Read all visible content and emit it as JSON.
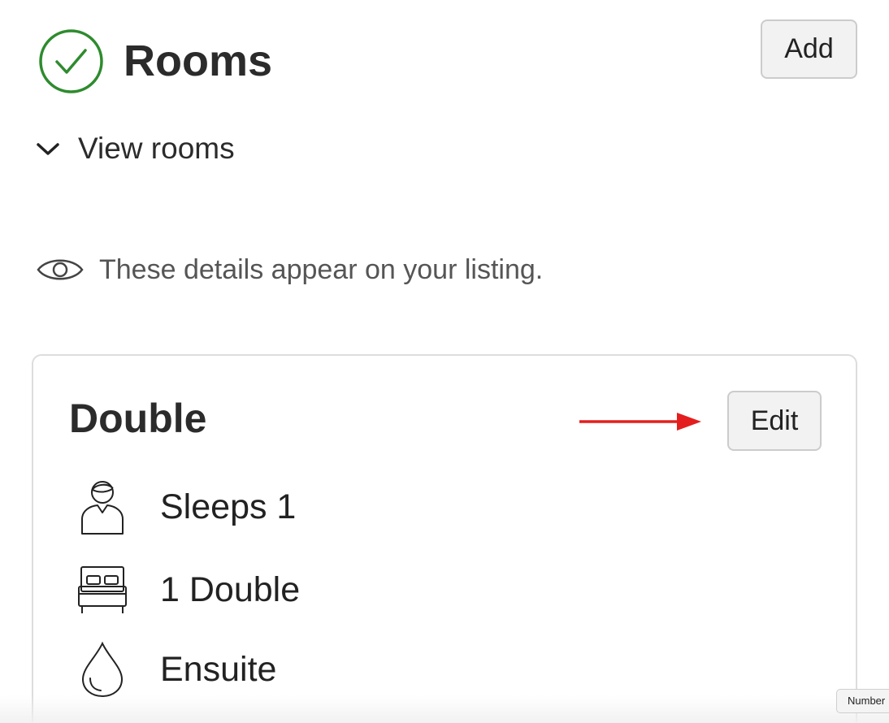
{
  "header": {
    "title": "Rooms",
    "add_label": "Add",
    "status_icon": "check-circle-icon",
    "status_color": "#2e8b2e"
  },
  "view_rooms": {
    "label": "View rooms",
    "icon": "chevron-down-icon"
  },
  "notice": {
    "icon": "eye-icon",
    "text": "These details appear on your listing."
  },
  "room": {
    "name": "Double",
    "edit_label": "Edit",
    "features": [
      {
        "icon": "person-icon",
        "label": "Sleeps 1"
      },
      {
        "icon": "bed-icon",
        "label": "1 Double"
      },
      {
        "icon": "water-drop-icon",
        "label": "Ensuite"
      }
    ]
  },
  "annotation": {
    "icon": "arrow-right-icon",
    "color": "#e41e1e"
  },
  "tooltip": {
    "text": "Number"
  }
}
